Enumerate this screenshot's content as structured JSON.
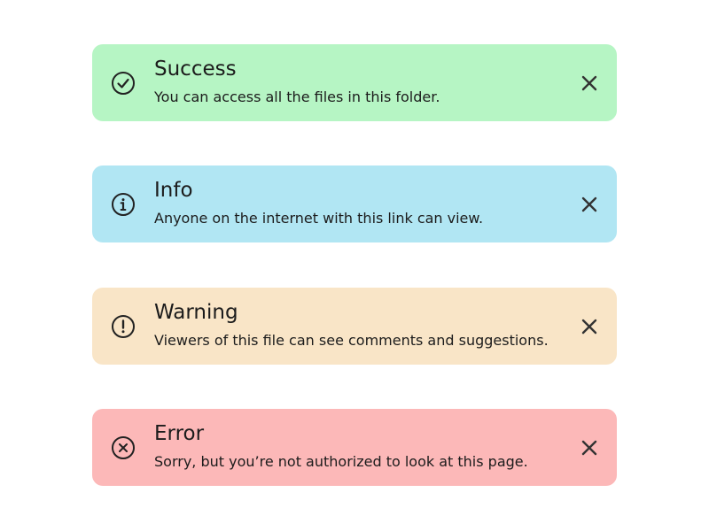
{
  "alerts": [
    {
      "type": "success",
      "icon": "check-circle-icon",
      "title": "Success",
      "message": "You can access all the files in this folder.",
      "background": "#b6f5c4",
      "close_icon": "close-icon"
    },
    {
      "type": "info",
      "icon": "info-circle-icon",
      "title": "Info",
      "message": "Anyone on the internet with this link can view.",
      "background": "#b1e6f3",
      "close_icon": "close-icon"
    },
    {
      "type": "warning",
      "icon": "exclamation-circle-icon",
      "title": "Warning",
      "message": "Viewers of this file can see comments and suggestions.",
      "background": "#f9e5c7",
      "close_icon": "close-icon"
    },
    {
      "type": "error",
      "icon": "x-circle-icon",
      "title": "Error",
      "message": "Sorry, but you’re not authorized to look at this page.",
      "background": "#fcb8b8",
      "close_icon": "close-icon"
    }
  ],
  "icon_color": "#222222"
}
